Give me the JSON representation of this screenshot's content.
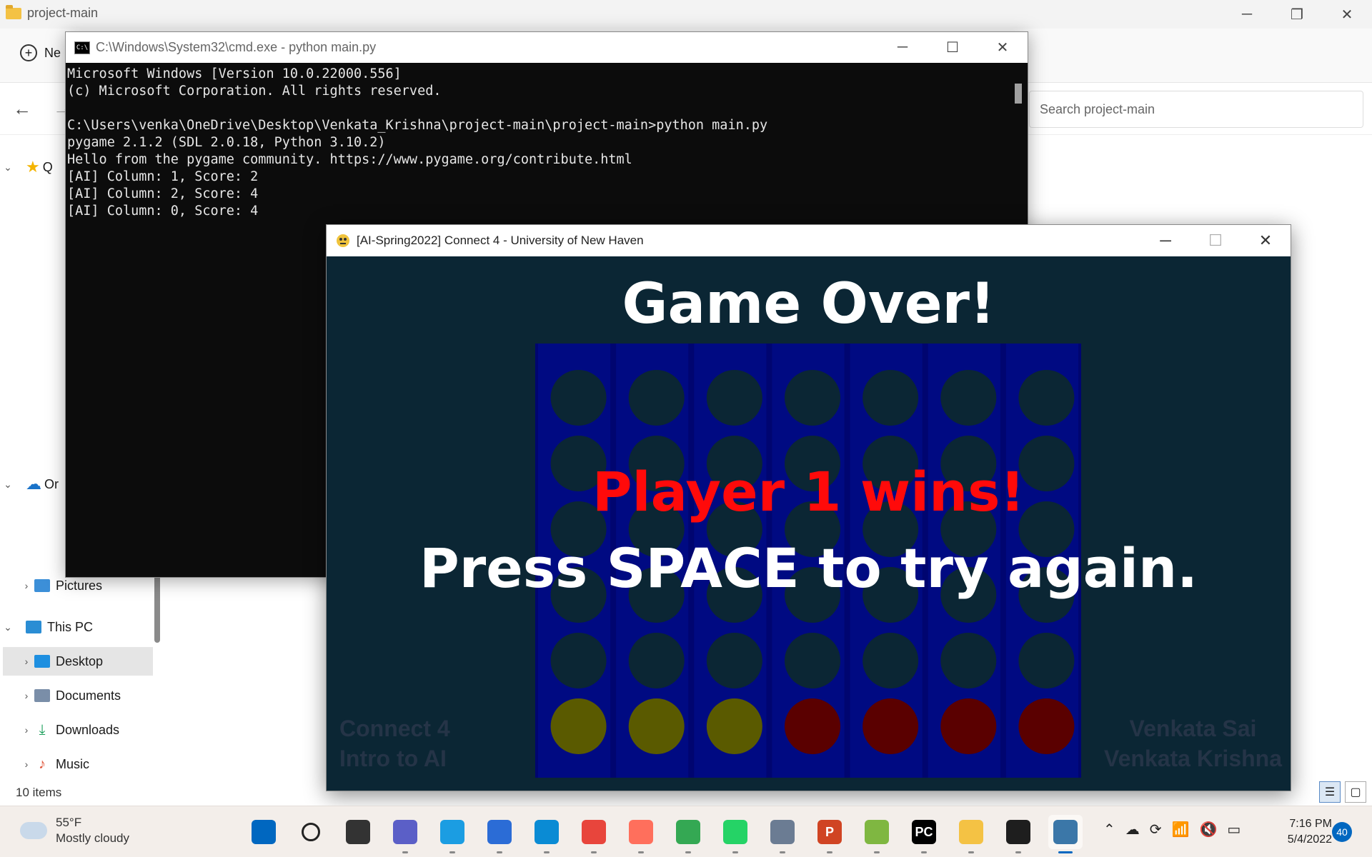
{
  "explorer": {
    "title": "project-main",
    "new_label": "Ne",
    "search_placeholder": "Search project-main",
    "status": "10 items",
    "sidebar": {
      "quick_access": "Q",
      "onedrive": "Or",
      "pictures": "Pictures",
      "this_pc": "This PC",
      "desktop": "Desktop",
      "documents": "Documents",
      "downloads": "Downloads",
      "music": "Music"
    }
  },
  "cmd": {
    "title": "C:\\Windows\\System32\\cmd.exe - python  main.py",
    "lines": [
      "Microsoft Windows [Version 10.0.22000.556]",
      "(c) Microsoft Corporation. All rights reserved.",
      "",
      "C:\\Users\\venka\\OneDrive\\Desktop\\Venkata_Krishna\\project-main\\project-main>python main.py",
      "pygame 2.1.2 (SDL 2.0.18, Python 3.10.2)",
      "Hello from the pygame community. https://www.pygame.org/contribute.html",
      "[AI] Column: 1, Score: 2",
      "[AI] Column: 2, Score: 4",
      "[AI] Column: 0, Score: 4"
    ]
  },
  "game": {
    "title": "[AI-Spring2022] Connect 4 - University of New Haven",
    "game_over": "Game Over!",
    "winner": "Player 1 wins!",
    "retry": "Press SPACE to try again.",
    "corner_left_1": "Connect 4",
    "corner_left_2": "Intro to AI",
    "corner_right_1": "Venkata Sai",
    "corner_right_2": "Venkata Krishna",
    "board": {
      "rows": 6,
      "cols": 7,
      "bottom_row": [
        "yellow",
        "yellow",
        "yellow",
        "red",
        "red",
        "red",
        "red"
      ],
      "colors": {
        "empty": "#0b2634",
        "yellow": "#5a5a00",
        "red": "#5a0000",
        "board": "#000570"
      }
    }
  },
  "taskbar": {
    "temp": "55°F",
    "condition": "Mostly cloudy",
    "time": "7:16 PM",
    "date": "5/4/2022",
    "notifications": "40",
    "apps": [
      {
        "name": "start-button",
        "glyph": "",
        "bg": "#0067c0"
      },
      {
        "name": "search-taskbar-button",
        "glyph": "",
        "bg": "transparent"
      },
      {
        "name": "task-view-button",
        "glyph": "",
        "bg": "#333333"
      },
      {
        "name": "teams-chat-button",
        "glyph": "",
        "bg": "#5b5fc7"
      },
      {
        "name": "edge-button",
        "glyph": "",
        "bg": "#1b9de2"
      },
      {
        "name": "store-button",
        "glyph": "",
        "bg": "#2b6cd6"
      },
      {
        "name": "app-button",
        "glyph": "",
        "bg": "#0a8bd4"
      },
      {
        "name": "chrome-button",
        "glyph": "",
        "bg": "#e8453c"
      },
      {
        "name": "app-button-2",
        "glyph": "",
        "bg": "#ff6f5c"
      },
      {
        "name": "chrome-profile-button",
        "glyph": "",
        "bg": "#34a853"
      },
      {
        "name": "whatsapp-button",
        "glyph": "",
        "bg": "#25d366"
      },
      {
        "name": "settings-button",
        "glyph": "",
        "bg": "#6b7c93"
      },
      {
        "name": "powerpoint-button",
        "glyph": "P",
        "bg": "#d04423"
      },
      {
        "name": "snip-button",
        "glyph": "",
        "bg": "#7fb741"
      },
      {
        "name": "pycharm-button",
        "glyph": "PC",
        "bg": "#000000"
      },
      {
        "name": "file-explorer-button",
        "glyph": "",
        "bg": "#f4c244"
      },
      {
        "name": "terminal-button",
        "glyph": "",
        "bg": "#1e1e1e"
      },
      {
        "name": "python-button",
        "glyph": "",
        "bg": "#3b77a8"
      }
    ]
  }
}
